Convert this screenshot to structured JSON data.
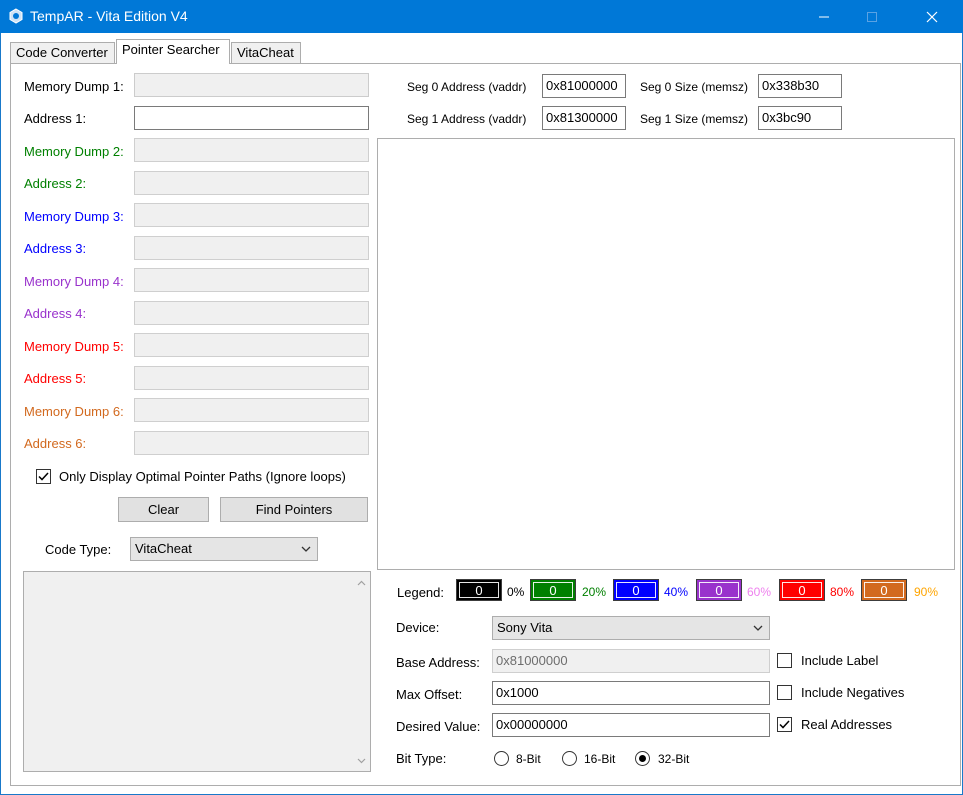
{
  "window": {
    "title": "TempAR - Vita Edition  V4"
  },
  "tabs": [
    {
      "label": "Code Converter"
    },
    {
      "label": "Pointer Searcher"
    },
    {
      "label": "VitaCheat"
    }
  ],
  "dumps": [
    {
      "dump_label": "Memory Dump 1:",
      "addr_label": "Address 1:",
      "color": "#000000"
    },
    {
      "dump_label": "Memory Dump 2:",
      "addr_label": "Address 2:",
      "color": "#008000"
    },
    {
      "dump_label": "Memory Dump 3:",
      "addr_label": "Address 3:",
      "color": "#0000ff"
    },
    {
      "dump_label": "Memory Dump 4:",
      "addr_label": "Address 4:",
      "color": "#9932cc"
    },
    {
      "dump_label": "Memory Dump 5:",
      "addr_label": "Address 5:",
      "color": "#ff0000"
    },
    {
      "dump_label": "Memory Dump 6:",
      "addr_label": "Address 6:",
      "color": "#d2691e"
    }
  ],
  "optimal_paths": {
    "label": "Only Display Optimal Pointer Paths (Ignore loops)",
    "checked": true
  },
  "buttons": {
    "clear": "Clear",
    "find_pointers": "Find Pointers"
  },
  "code_type": {
    "label": "Code Type:",
    "value": "VitaCheat"
  },
  "segments": {
    "seg0_address_label": "Seg 0 Address (vaddr)",
    "seg0_address_value": "0x81000000",
    "seg0_size_label": "Seg 0 Size (memsz)",
    "seg0_size_value": "0x338b30",
    "seg1_address_label": "Seg 1 Address (vaddr)",
    "seg1_address_value": "0x81300000",
    "seg1_size_label": "Seg 1 Size (memsz)",
    "seg1_size_value": "0x3bc90"
  },
  "legend": {
    "label": "Legend:",
    "items": [
      {
        "value": "0",
        "pct": "0%",
        "color": "#000000",
        "pct_color": "#000000"
      },
      {
        "value": "0",
        "pct": "20%",
        "color": "#008000",
        "pct_color": "#008000"
      },
      {
        "value": "0",
        "pct": "40%",
        "color": "#0000ff",
        "pct_color": "#0000ff"
      },
      {
        "value": "0",
        "pct": "60%",
        "color": "#9932cc",
        "pct_color": "#ee82ee"
      },
      {
        "value": "0",
        "pct": "80%",
        "color": "#ff0000",
        "pct_color": "#ff0000"
      },
      {
        "value": "0",
        "pct": "90%",
        "color": "#d2691e",
        "pct_color": "#ffa500"
      }
    ]
  },
  "device": {
    "label": "Device:",
    "value": "Sony Vita"
  },
  "base_address": {
    "label": "Base Address:",
    "value": "0x81000000"
  },
  "max_offset": {
    "label": "Max Offset:",
    "value": "0x1000"
  },
  "desired_value": {
    "label": "Desired Value:",
    "value": "0x00000000"
  },
  "include_label": {
    "label": "Include Label",
    "checked": false
  },
  "include_negatives": {
    "label": "Include Negatives",
    "checked": false
  },
  "real_addresses": {
    "label": "Real Addresses",
    "checked": true
  },
  "bit_type": {
    "label": "Bit Type:",
    "options": [
      "8-Bit",
      "16-Bit",
      "32-Bit"
    ],
    "selected": "32-Bit"
  }
}
